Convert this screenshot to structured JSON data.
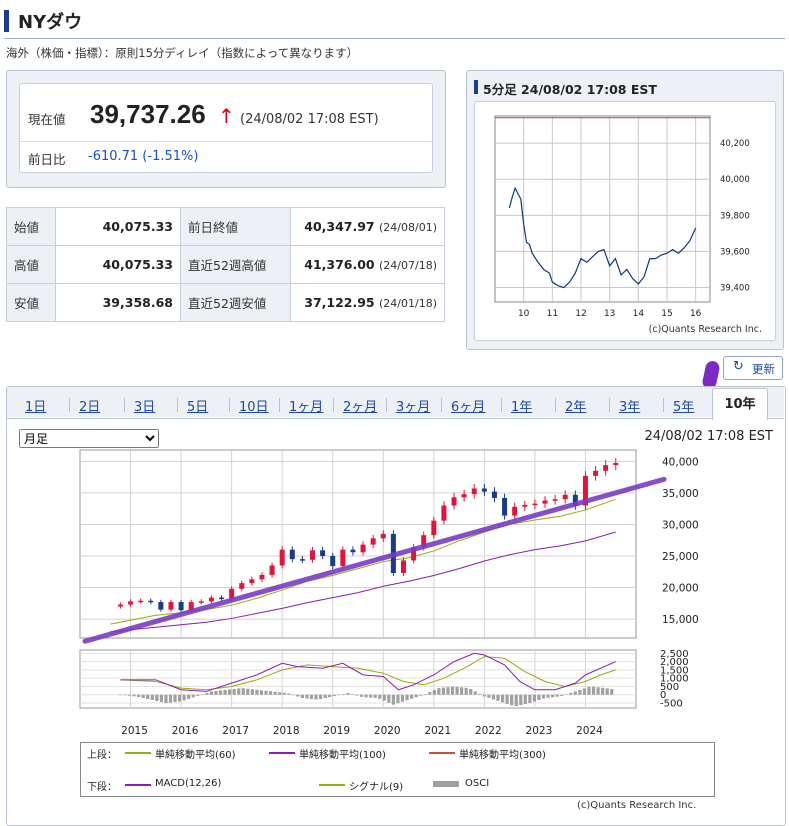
{
  "header": {
    "title": "NYダウ"
  },
  "note": "海外（株価・指標）：原則15分ディレイ（指数によって異なります）",
  "quote": {
    "current_label": "現在値",
    "current_value": "39,737.26",
    "arrow": "↑",
    "timestamp": "(24/08/02 17:08 EST)",
    "change_label": "前日比",
    "change_value": "-610.71 (-1.51%)"
  },
  "stats": [
    {
      "label": "始値",
      "value": "40,075.33",
      "label2": "前日終値",
      "value2": "40,347.97",
      "date2": "(24/08/01)"
    },
    {
      "label": "高値",
      "value": "40,075.33",
      "label2": "直近52週高値",
      "value2": "41,376.00",
      "date2": "(24/07/18)"
    },
    {
      "label": "安値",
      "value": "39,358.68",
      "label2": "直近52週安値",
      "value2": "37,122.95",
      "date2": "(24/01/18)"
    }
  ],
  "intraday": {
    "title": "5分足 24/08/02 17:08 EST",
    "credit": "(c)Quants Research Inc.",
    "colors": {
      "line": "#0b3a78",
      "ref_line": "#c0395a"
    },
    "chart_data": {
      "type": "line",
      "x": [
        9.5,
        9.6,
        9.7,
        9.8,
        9.9,
        10.0,
        10.1,
        10.2,
        10.3,
        10.5,
        10.7,
        10.9,
        11.0,
        11.1,
        11.2,
        11.4,
        11.6,
        11.8,
        12.0,
        12.2,
        12.4,
        12.6,
        12.8,
        13.0,
        13.2,
        13.4,
        13.6,
        13.8,
        14.0,
        14.2,
        14.4,
        14.6,
        14.8,
        15.0,
        15.2,
        15.4,
        15.6,
        15.8,
        16.0
      ],
      "values": [
        39840,
        39900,
        39950,
        39920,
        39890,
        39750,
        39650,
        39640,
        39590,
        39540,
        39500,
        39480,
        39430,
        39420,
        39410,
        39400,
        39430,
        39480,
        39560,
        39540,
        39570,
        39600,
        39610,
        39520,
        39560,
        39470,
        39500,
        39450,
        39420,
        39460,
        39560,
        39560,
        39580,
        39590,
        39610,
        39590,
        39620,
        39660,
        39730
      ],
      "ref_value": 40340,
      "x_ticks": [
        "10",
        "11",
        "12",
        "13",
        "14",
        "15",
        "16"
      ],
      "x_tick_values": [
        10,
        11,
        12,
        13,
        14,
        15,
        16
      ],
      "y_ticks": [
        "40,200",
        "40,000",
        "39,800",
        "39,600",
        "39,400"
      ],
      "y_tick_values": [
        40200,
        40000,
        39800,
        39600,
        39400
      ],
      "xlim": [
        9.0,
        16.5
      ],
      "ylim": [
        39320,
        40350
      ],
      "grid": true
    }
  },
  "refresh_label": "更新",
  "tabs": [
    "1日",
    "2日",
    "3日",
    "5日",
    "10日",
    "1ヶ月",
    "2ヶ月",
    "3ヶ月",
    "6ヶ月",
    "1年",
    "2年",
    "3年",
    "5年"
  ],
  "active_tab": "10年",
  "period_select": {
    "selected": "月足"
  },
  "main_timestamp": "24/08/02 17:08 EST",
  "main_chart": {
    "colors": {
      "up": "#e0143c",
      "down": "#1a3a8a",
      "ma60": "#9aaa10",
      "ma100": "#8a1cb0",
      "ma300": "#c85030",
      "macd": "#8a1cb0",
      "signal": "#9aaa10",
      "osci": "#a0a0a0"
    },
    "chart_data": {
      "type": "candlestick",
      "x_ticks": [
        "2015",
        "2016",
        "2017",
        "2018",
        "2019",
        "2020",
        "2021",
        "2022",
        "2023",
        "2024"
      ],
      "y_ticks": [
        "40,000",
        "35,000",
        "30,000",
        "25,000",
        "20,000",
        "15,000"
      ],
      "y_tick_values": [
        40000,
        35000,
        30000,
        25000,
        20000,
        15000
      ],
      "xlim": [
        2014.0,
        2025.0
      ],
      "ylim": [
        12000,
        41800
      ],
      "close_series": {
        "x": [
          2014.6,
          2014.8,
          2015.0,
          2015.2,
          2015.4,
          2015.6,
          2015.8,
          2016.0,
          2016.2,
          2016.4,
          2016.6,
          2016.8,
          2017.0,
          2017.2,
          2017.4,
          2017.6,
          2017.8,
          2018.0,
          2018.2,
          2018.4,
          2018.6,
          2018.8,
          2019.0,
          2019.2,
          2019.4,
          2019.6,
          2019.8,
          2020.0,
          2020.2,
          2020.4,
          2020.6,
          2020.8,
          2021.0,
          2021.2,
          2021.4,
          2021.6,
          2021.8,
          2022.0,
          2022.2,
          2022.4,
          2022.6,
          2022.8,
          2023.0,
          2023.2,
          2023.4,
          2023.6,
          2023.8,
          2024.0,
          2024.2,
          2024.4,
          2024.6
        ],
        "values": [
          17000,
          17300,
          17800,
          17900,
          17700,
          16500,
          17700,
          16400,
          17700,
          17800,
          18400,
          18200,
          19800,
          20700,
          21300,
          22000,
          23500,
          26000,
          24500,
          24400,
          25900,
          25000,
          23400,
          26000,
          25600,
          26800,
          27800,
          28500,
          22300,
          24300,
          26400,
          28300,
          30600,
          33000,
          34300,
          34800,
          35700,
          35200,
          34200,
          31400,
          32800,
          33100,
          33300,
          33800,
          34000,
          34700,
          33000,
          37700,
          38500,
          39400,
          39737
        ]
      },
      "ma60": {
        "x": [
          2014.6,
          2015.5,
          2016.0,
          2016.5,
          2017.0,
          2017.5,
          2018.0,
          2018.5,
          2019.0,
          2019.5,
          2020.0,
          2020.5,
          2021.0,
          2021.5,
          2022.0,
          2022.5,
          2023.0,
          2023.5,
          2024.0,
          2024.6
        ],
        "values": [
          14200,
          15600,
          16000,
          16500,
          17200,
          18300,
          19600,
          21000,
          21900,
          23000,
          24100,
          24700,
          25800,
          27400,
          28800,
          30000,
          30700,
          31300,
          32300,
          34000
        ]
      },
      "ma100": {
        "x": [
          2014.6,
          2015.5,
          2016.0,
          2016.5,
          2017.0,
          2017.5,
          2018.0,
          2018.5,
          2019.0,
          2019.5,
          2020.0,
          2020.5,
          2021.0,
          2021.5,
          2022.0,
          2022.5,
          2023.0,
          2023.5,
          2024.0,
          2024.6
        ],
        "values": [
          13000,
          13700,
          14100,
          14500,
          15100,
          15900,
          16700,
          17600,
          18400,
          19200,
          20200,
          21000,
          21900,
          23000,
          24200,
          25200,
          26000,
          26600,
          27400,
          28800
        ]
      },
      "trendline": {
        "x": [
          2014.0,
          2025.0
        ],
        "values": [
          11800,
          36200
        ]
      }
    },
    "macd_data": {
      "type": "line",
      "y_ticks": [
        "2,500",
        "2,000",
        "1,500",
        "1,000",
        "500",
        "0",
        "-500"
      ],
      "y_tick_values": [
        2500,
        2000,
        1500,
        1000,
        500,
        0,
        -500
      ],
      "ylim": [
        -800,
        2700
      ],
      "macd": {
        "x": [
          2014.8,
          2015.5,
          2016.0,
          2016.5,
          2017.0,
          2017.5,
          2018.0,
          2018.3,
          2018.8,
          2019.2,
          2019.6,
          2020.0,
          2020.3,
          2020.6,
          2021.0,
          2021.4,
          2021.8,
          2022.0,
          2022.4,
          2022.7,
          2023.0,
          2023.4,
          2023.8,
          2024.0,
          2024.3,
          2024.6
        ],
        "values": [
          900,
          900,
          300,
          200,
          700,
          1200,
          1900,
          1700,
          1600,
          1900,
          1200,
          1100,
          300,
          600,
          1200,
          2000,
          2500,
          2400,
          1800,
          800,
          300,
          300,
          700,
          1200,
          1600,
          2000
        ]
      },
      "signal": {
        "x": [
          2014.8,
          2015.5,
          2016.0,
          2016.5,
          2017.0,
          2017.5,
          2018.0,
          2018.5,
          2019.0,
          2019.5,
          2020.0,
          2020.4,
          2020.8,
          2021.2,
          2021.6,
          2022.0,
          2022.4,
          2022.8,
          2023.2,
          2023.6,
          2024.0,
          2024.3,
          2024.6
        ],
        "values": [
          900,
          800,
          400,
          300,
          500,
          900,
          1500,
          1800,
          1700,
          1600,
          1300,
          800,
          600,
          1000,
          1600,
          2300,
          2200,
          1400,
          800,
          500,
          800,
          1200,
          1500
        ]
      },
      "osci": {
        "x": [
          2014.8,
          2015.1,
          2015.4,
          2015.7,
          2016.0,
          2016.3,
          2016.6,
          2016.9,
          2017.2,
          2017.5,
          2017.8,
          2018.1,
          2018.4,
          2018.7,
          2019.0,
          2019.3,
          2019.6,
          2019.9,
          2020.2,
          2020.5,
          2020.8,
          2021.1,
          2021.4,
          2021.7,
          2022.0,
          2022.3,
          2022.6,
          2022.9,
          2023.2,
          2023.5,
          2023.8,
          2024.1,
          2024.4,
          2024.6
        ],
        "values": [
          0,
          -100,
          -300,
          -500,
          -400,
          -100,
          200,
          300,
          400,
          300,
          200,
          100,
          -200,
          -300,
          -100,
          100,
          -150,
          -200,
          -600,
          -300,
          0,
          400,
          500,
          400,
          -100,
          -400,
          -700,
          -500,
          -200,
          -100,
          200,
          500,
          400,
          300
        ]
      }
    }
  },
  "legend": {
    "top_label": "上段：",
    "ma60": "単純移動平均(60)",
    "ma100": "単純移動平均(100)",
    "ma300": "単純移動平均(300)",
    "bottom_label": "下段：",
    "macd": "MACD(12,26)",
    "signal": "シグナル(9)",
    "osci": "OSCI"
  },
  "main_credit": "(c)Quants Research Inc."
}
